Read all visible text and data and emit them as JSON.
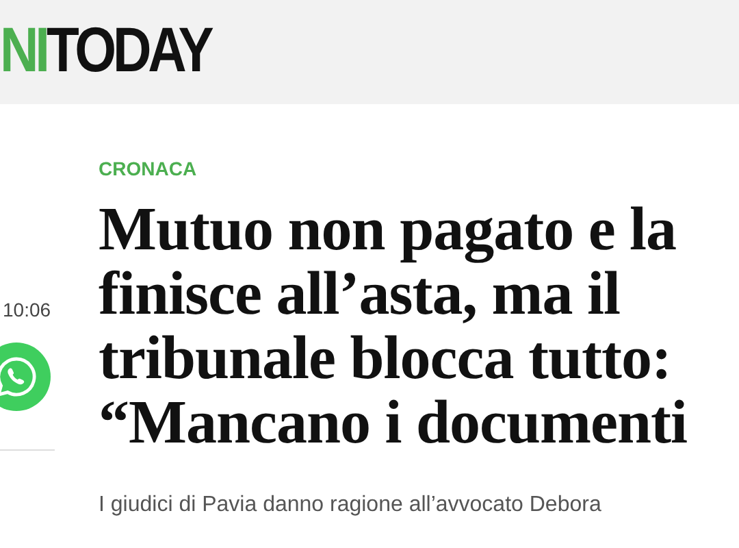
{
  "header": {
    "logo": [
      {
        "text": "NI",
        "kind": "accent"
      },
      {
        "text": "TODAY",
        "kind": "plain"
      }
    ]
  },
  "sidebar": {
    "time": "10:06"
  },
  "article": {
    "category": "CRONACA",
    "title_lines": [
      "Mutuo non pagato e la",
      "finisce all’asta, ma il",
      "tribunale blocca tutto:",
      "“Mancano i documenti"
    ],
    "subtitle": "I giudici di Pavia danno ragione all’avvocato Debora"
  }
}
